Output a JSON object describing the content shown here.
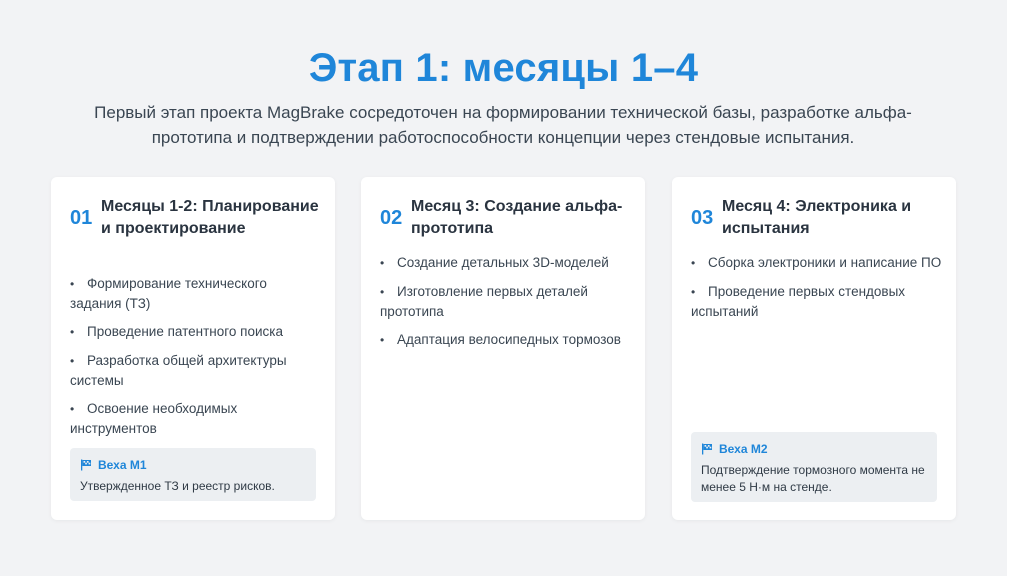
{
  "header": {
    "title": "Этап 1: месяцы 1–4",
    "subtitle": "Первый этап проекта MagBrake сосредоточен на формировании технической базы, разработке альфа-прототипа и подтверждении работоспособности концепции через стендовые испытания."
  },
  "colors": {
    "accent": "#1f86d9",
    "background": "#f2f3f5",
    "card": "#ffffff",
    "milestone_bg": "#eceff2"
  },
  "cards": [
    {
      "number": "01",
      "title": "Месяцы 1-2: Планирование и проектирование",
      "items": [
        "Формирование технического задания (ТЗ)",
        "Проведение патентного поиска",
        "Разработка общей архитектуры системы",
        "Освоение необходимых инструментов"
      ],
      "milestone": {
        "icon": "flag-icon",
        "label": "Веха М1",
        "text": "Утвержденное ТЗ и реестр рисков."
      }
    },
    {
      "number": "02",
      "title": "Месяц 3: Создание альфа-прототипа",
      "items": [
        "Создание детальных 3D-моделей",
        "Изготовление первых деталей прототипа",
        "Адаптация велосипедных тормозов"
      ]
    },
    {
      "number": "03",
      "title": "Месяц 4: Электроника и испытания",
      "items": [
        "Сборка электроники и написание ПО",
        "Проведение первых стендовых испытаний"
      ],
      "milestone": {
        "icon": "flag-icon",
        "label": "Веха М2",
        "text": "Подтверждение тормозного момента не менее 5 Н·м на стенде."
      }
    }
  ]
}
